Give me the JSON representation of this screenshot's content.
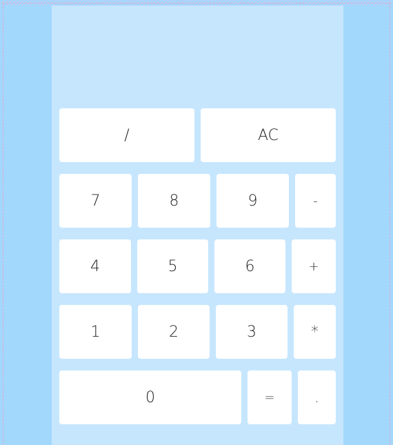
{
  "calculator": {
    "display": "",
    "keys": {
      "divide": "/",
      "clear": "AC",
      "seven": "7",
      "eight": "8",
      "nine": "9",
      "minus": "-",
      "four": "4",
      "five": "5",
      "six": "6",
      "plus": "+",
      "one": "1",
      "two": "2",
      "three": "3",
      "multiply": "*",
      "zero": "0",
      "equals": "=",
      "decimal": "."
    }
  },
  "colors": {
    "page_background": "#a3d8fd",
    "panel_background": "#c6e6fe",
    "key_background": "#ffffff"
  }
}
